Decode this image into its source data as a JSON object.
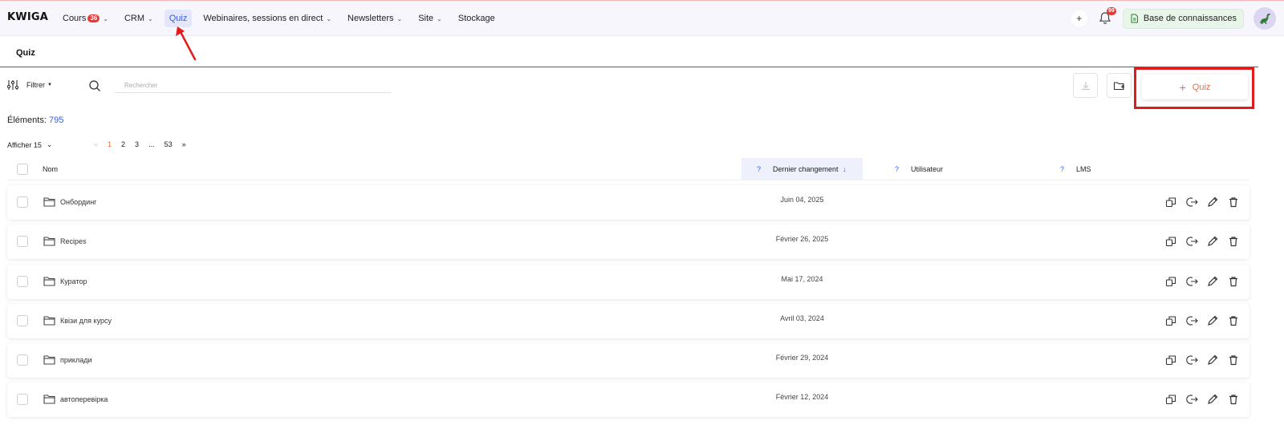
{
  "app": {
    "logo": "KWIGA"
  },
  "nav": [
    {
      "label": "Cours",
      "badge": "36",
      "dropdown": true
    },
    {
      "label": "CRM",
      "dropdown": true
    },
    {
      "label": "Quiz",
      "active": true
    },
    {
      "label": "Webinaires, sessions en direct",
      "dropdown": true
    },
    {
      "label": "Newsletters",
      "dropdown": true
    },
    {
      "label": "Site",
      "dropdown": true
    },
    {
      "label": "Stockage"
    }
  ],
  "top_right": {
    "add_icon": "plus-icon",
    "notifications_count": "99",
    "knowledge_base_label": "Base de connaissances"
  },
  "page": {
    "title": "Quiz"
  },
  "toolbar": {
    "filter_label": "Filtrer",
    "search_placeholder": "Rechercher",
    "add_quiz_label": "Quiz"
  },
  "summary": {
    "elements_label": "Éléments:",
    "elements_count": "795"
  },
  "paging": {
    "show_label": "Afficher 15",
    "first": "«",
    "pages": [
      "1",
      "2",
      "3",
      "...",
      "53"
    ],
    "last": "»",
    "current": "1"
  },
  "table": {
    "columns": {
      "name": "Nom",
      "last_change": "Dernier changement",
      "user": "Utilisateur",
      "lms": "LMS",
      "help": "?"
    },
    "rows": [
      {
        "name": "Онбординг",
        "date": "Juin 04, 2025"
      },
      {
        "name": "Recipes",
        "date": "Février 26, 2025"
      },
      {
        "name": "Куратор",
        "date": "Mai 17, 2024"
      },
      {
        "name": "Квізи для курсу",
        "date": "Avril 03, 2024"
      },
      {
        "name": "приклади",
        "date": "Février 29, 2024"
      },
      {
        "name": "автоперевірка",
        "date": "Février 12, 2024"
      }
    ]
  },
  "colors": {
    "accent": "#3b5bdb",
    "orange": "#f26b3a",
    "highlight": "#e01c1c"
  }
}
